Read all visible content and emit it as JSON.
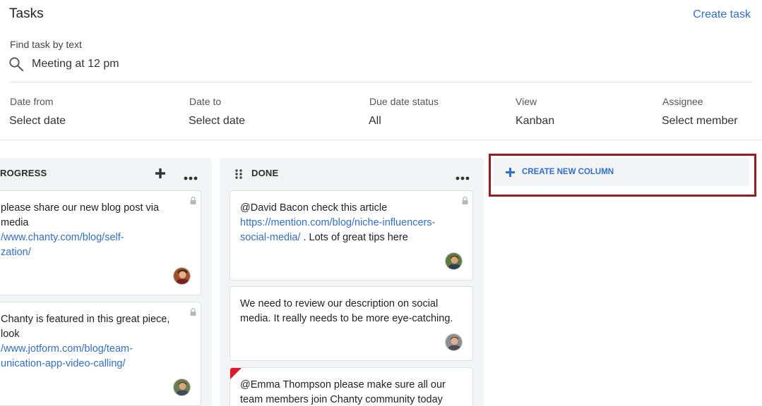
{
  "header": {
    "title": "Tasks",
    "create_task": "Create task"
  },
  "search": {
    "label": "Find task by text",
    "value": "Meeting at 12 pm"
  },
  "filters": {
    "date_from": {
      "label": "Date from",
      "value": "Select date"
    },
    "date_to": {
      "label": "Date to",
      "value": "Select date"
    },
    "due_status": {
      "label": "Due date status",
      "value": "All"
    },
    "view": {
      "label": "View",
      "value": "Kanban"
    },
    "assignee": {
      "label": "Assignee",
      "value": "Select member"
    }
  },
  "columns": {
    "progress": {
      "title": "ROGRESS",
      "cards": [
        {
          "text": " please share our new blog post via",
          "text2": "media",
          "link": "/www.chanty.com/blog/self-",
          "link2": "zation/"
        },
        {
          "text": "Chanty is featured in this great piece,",
          "text2": "look",
          "link": "/www.jotform.com/blog/team-",
          "link2": "unication-app-video-calling/"
        }
      ]
    },
    "done": {
      "title": "DONE",
      "cards": [
        {
          "text": "@David Bacon check this article",
          "link": "https://mention.com/blog/niche-influencers-",
          "link2": "social-media/",
          "text2": " . Lots of great tips here"
        },
        {
          "text": "We need to review our description on social",
          "text2": "media. It really needs to be more eye-catching."
        },
        {
          "text": "@Emma Thompson please make sure all our",
          "text2": "team members join Chanty community today"
        }
      ]
    }
  },
  "create_column": {
    "label": "CREATE NEW COLUMN"
  },
  "colors": {
    "accent": "#2f6fd0",
    "highlight_border": "#9b1c1c",
    "priority": "#e0192a"
  }
}
